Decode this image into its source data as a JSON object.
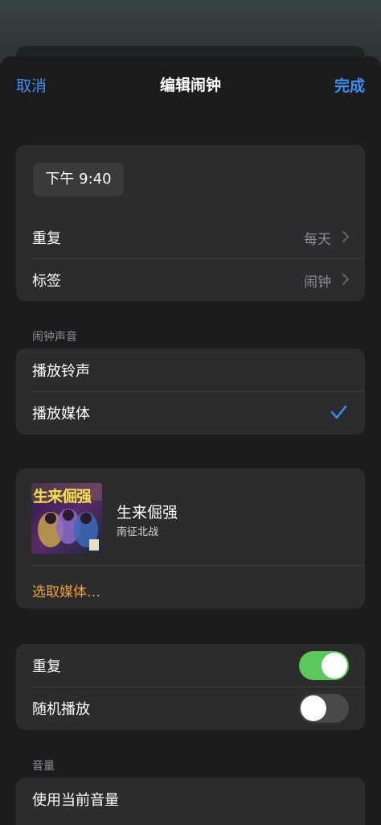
{
  "nav": {
    "cancel": "取消",
    "title": "编辑闹钟",
    "done": "完成"
  },
  "time": {
    "value": "下午 9:40"
  },
  "settings": {
    "repeat_label": "重复",
    "repeat_value": "每天",
    "label_label": "标签",
    "label_value": "闹钟"
  },
  "sound": {
    "header": "闹钟声音",
    "options": [
      {
        "label": "播放铃声",
        "checked": false
      },
      {
        "label": "播放媒体",
        "checked": true
      }
    ]
  },
  "media": {
    "title": "生来倔强",
    "artist": "南征北战",
    "art_text": "生来倔强",
    "choose": "选取媒体…"
  },
  "playback": {
    "repeat_label": "重复",
    "repeat_on": true,
    "shuffle_label": "随机播放",
    "shuffle_on": false
  },
  "volume": {
    "header": "音量",
    "use_current": "使用当前音量"
  },
  "colors": {
    "accent": "#3f8ef8",
    "orange": "#f0a030",
    "toggle_on": "#5ac85a"
  }
}
